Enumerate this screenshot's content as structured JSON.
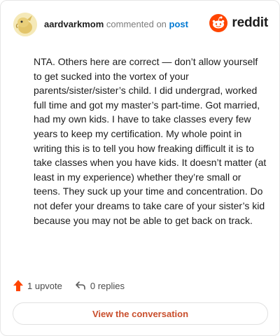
{
  "header": {
    "username": "aardvarkmom",
    "action_text": "commented on",
    "post_link": "post",
    "brand": "reddit"
  },
  "comment": {
    "text": "NTA. Others here are correct — don’t allow yourself to get sucked into the vortex of your parents/sister/sister’s child. I did undergrad, worked full time and got my master’s part-time. Got married, had my own kids. I have to take classes every few years to keep my certification. My whole point in writing this is to tell you how freaking difficult it is to take classes when you have kids. It doesn’t matter (at least in my experience) whether they’re small or teens. They suck up your time and concentration. Do not defer your dreams to take care of your sister’s kid because you may not be able to get back on track."
  },
  "actions": {
    "upvote_label": "1 upvote",
    "replies_label": "0 replies"
  },
  "cta": {
    "label": "View the conversation"
  },
  "colors": {
    "accent": "#ff4500",
    "cta_text": "#c94e2c",
    "link": "#0079d3"
  },
  "icons": {
    "avatar": "avatar-icon",
    "brand": "reddit-logo-icon",
    "upvote": "upvote-arrow-icon",
    "reply": "reply-arrow-icon"
  }
}
